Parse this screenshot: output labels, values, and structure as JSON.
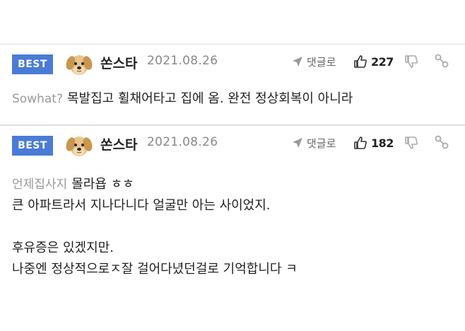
{
  "comments": [
    {
      "badge": "BEST",
      "author": "쏜스타",
      "date": "2021.08.26",
      "reply_label": "댓글로",
      "like_count": "227",
      "avatar_icon": "puppy-avatar-icon",
      "mention": "Sowhat?",
      "text": "목발집고 휠채어타고 집에 옴. 완전 정상회복이 아니라"
    },
    {
      "badge": "BEST",
      "author": "쏜스타",
      "date": "2021.08.26",
      "reply_label": "댓글로",
      "like_count": "182",
      "avatar_icon": "puppy-avatar-icon",
      "mention": "언제집사지",
      "lines": [
        "몰라욥 ㅎㅎ",
        "큰 아파트라서 지나다니다 얼굴만 아는 사이었지.",
        "",
        "후유증은 있겠지만.",
        "나중엔 정상적으로ㅈ잘 걸어다녔던걸로 기억합니다 ㅋ"
      ]
    }
  ],
  "colors": {
    "badge_bg": "#4a7bd6",
    "divider": "#dcdfe6",
    "icon_gray": "#999999"
  }
}
